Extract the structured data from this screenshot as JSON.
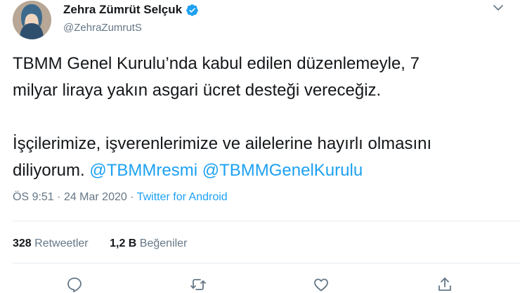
{
  "author": {
    "display_name": "Zehra Zümrüt Selçuk",
    "handle": "@ZehraZumrutS",
    "verified": true
  },
  "tweet": {
    "line1": "TBMM Genel Kurulu’nda kabul edilen düzenlemeyle, 7",
    "line2": "milyar liraya yakın asgari ücret desteği vereceğiz.",
    "line3": "İşçilerimize, işverenlerimize ve ailelerine hayırlı olmasını",
    "line4_prefix": "diliyorum.",
    "mention1": "@TBMMresmi",
    "mention2": "@TBMMGenelKurulu"
  },
  "meta": {
    "time": "ÖS 9:51",
    "separator": "·",
    "date": "24 Mar 2020",
    "source": "Twitter for Android"
  },
  "stats": {
    "retweets_count": "328",
    "retweets_label": "Retweetler",
    "likes_count": "1,2 B",
    "likes_label": "Beğeniler"
  },
  "icons": {
    "reply": "reply-icon",
    "retweet": "retweet-icon",
    "like": "heart-icon",
    "share": "share-icon",
    "menu": "chevron-down-icon",
    "verified": "verified-badge-icon"
  },
  "colors": {
    "accent": "#1da1f2",
    "text": "#14171a",
    "muted": "#657786",
    "divider": "#e6ecf0"
  }
}
